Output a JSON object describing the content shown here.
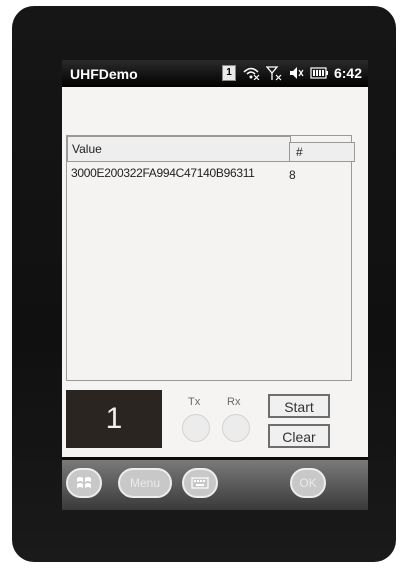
{
  "titlebar": {
    "app_title": "UHFDemo",
    "badge": "1",
    "clock": "6:42"
  },
  "list": {
    "columns": [
      "Value",
      "#"
    ],
    "rows": [
      {
        "value": "3000E200322FA994C47140B96311",
        "count": "8"
      }
    ]
  },
  "status": {
    "read_count": "1",
    "tx_label": "Tx",
    "rx_label": "Rx"
  },
  "buttons": {
    "start": "Start",
    "clear": "Clear"
  },
  "softkeys": {
    "menu": "Menu",
    "ok": "OK"
  },
  "icons": {
    "titlebar": [
      "wifi-icon",
      "signal-icon",
      "volume-icon",
      "battery-icon"
    ],
    "softkeys": [
      "windows-start-icon",
      "keyboard-icon"
    ]
  }
}
